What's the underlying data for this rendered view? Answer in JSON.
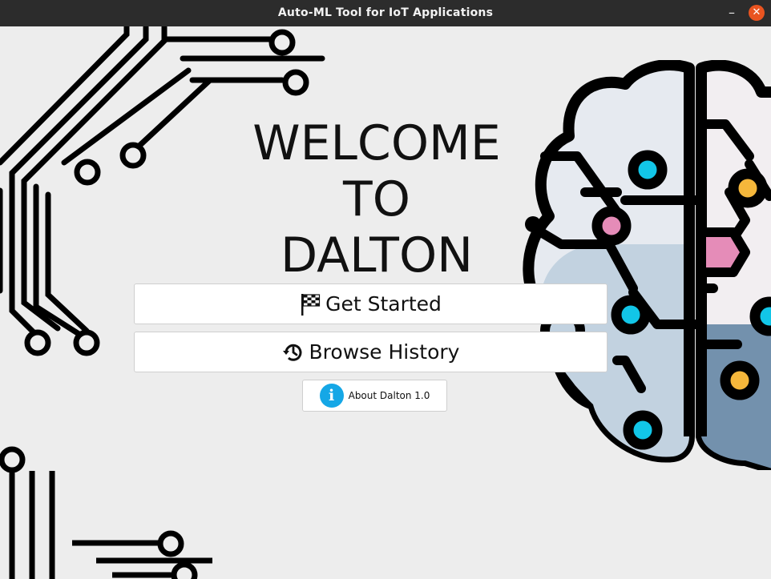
{
  "window": {
    "title": "Auto-ML Tool for IoT Applications",
    "minimize_glyph": "–",
    "close_glyph": "✕"
  },
  "welcome": {
    "line1": "WELCOME",
    "line2": "TO",
    "line3": "DALTON"
  },
  "buttons": {
    "get_started": "Get Started",
    "browse_history": "Browse History",
    "about": "About Dalton 1.0"
  },
  "icons": {
    "get_started": "checkered-flag-icon",
    "browse_history": "history-icon",
    "about": "info-icon",
    "decoration_left": "circuit-lines",
    "decoration_right": "circuit-brain"
  },
  "colors": {
    "background": "#ededed",
    "titlebar": "#2c2c2c",
    "close_button": "#e95420",
    "info_icon": "#15a7e6",
    "brain_cyan": "#12c6e8",
    "brain_orange": "#f5b73b",
    "brain_pink": "#e58cb8",
    "brain_blue": "#6f8faa"
  }
}
